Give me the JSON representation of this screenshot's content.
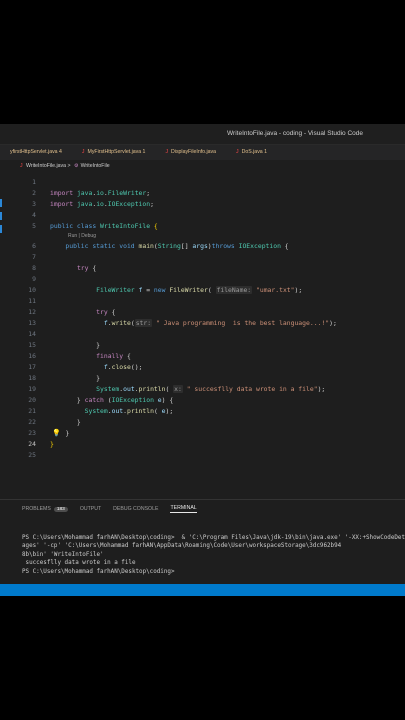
{
  "window": {
    "title": "WriteIntoFile.java - coding - Visual Studio Code"
  },
  "tabs": [
    {
      "label": "yfirstHttpServlet.java 4",
      "active": false,
      "type_icon": ""
    },
    {
      "label": "MyFirstHttpServlet.java 1",
      "active": false,
      "type_icon": "J"
    },
    {
      "label": "DisplayFileInfo.java",
      "active": false,
      "type_icon": "J"
    },
    {
      "label": "DoS.java 1",
      "active": false,
      "type_icon": "J"
    }
  ],
  "breadcrumb": {
    "file": "WriteIntoFile.java",
    "separator": ">",
    "symbol": "WriteIntoFile"
  },
  "editor": {
    "codelens": "Run | Debug",
    "line_numbers": [
      "1",
      "2",
      "3",
      "4",
      "5",
      "6",
      "7",
      "8",
      "9",
      "10",
      "11",
      "12",
      "13",
      "14",
      "15",
      "16",
      "17",
      "18",
      "19",
      "20",
      "21",
      "22",
      "23",
      "24",
      "25"
    ],
    "current_line": "24"
  },
  "panel": {
    "tabs": [
      {
        "label": "PROBLEMS",
        "badge": "183",
        "active": false
      },
      {
        "label": "OUTPUT",
        "active": false
      },
      {
        "label": "DEBUG CONSOLE",
        "active": false
      },
      {
        "label": "TERMINAL",
        "active": true
      }
    ],
    "terminal_lines": [
      "PS C:\\Users\\Mohammad farhAN\\Desktop\\coding>  & 'C:\\Program Files\\Java\\jdk-19\\bin\\java.exe' '-XX:+ShowCodeDetailsInExceptionMess",
      "ages' '-cp' 'C:\\Users\\Mohammad farhAN\\AppData\\Roaming\\Code\\User\\workspaceStorage\\3dc962b94",
      "8b\\bin' 'WriteIntoFile'",
      " succesflly data wrote in a file",
      "PS C:\\Users\\Mohammad farhAN\\Desktop\\coding>"
    ]
  },
  "colors": {
    "status_bar": "#007acc",
    "accent_tab": "#e8a55a",
    "java_icon": "#f44747"
  }
}
